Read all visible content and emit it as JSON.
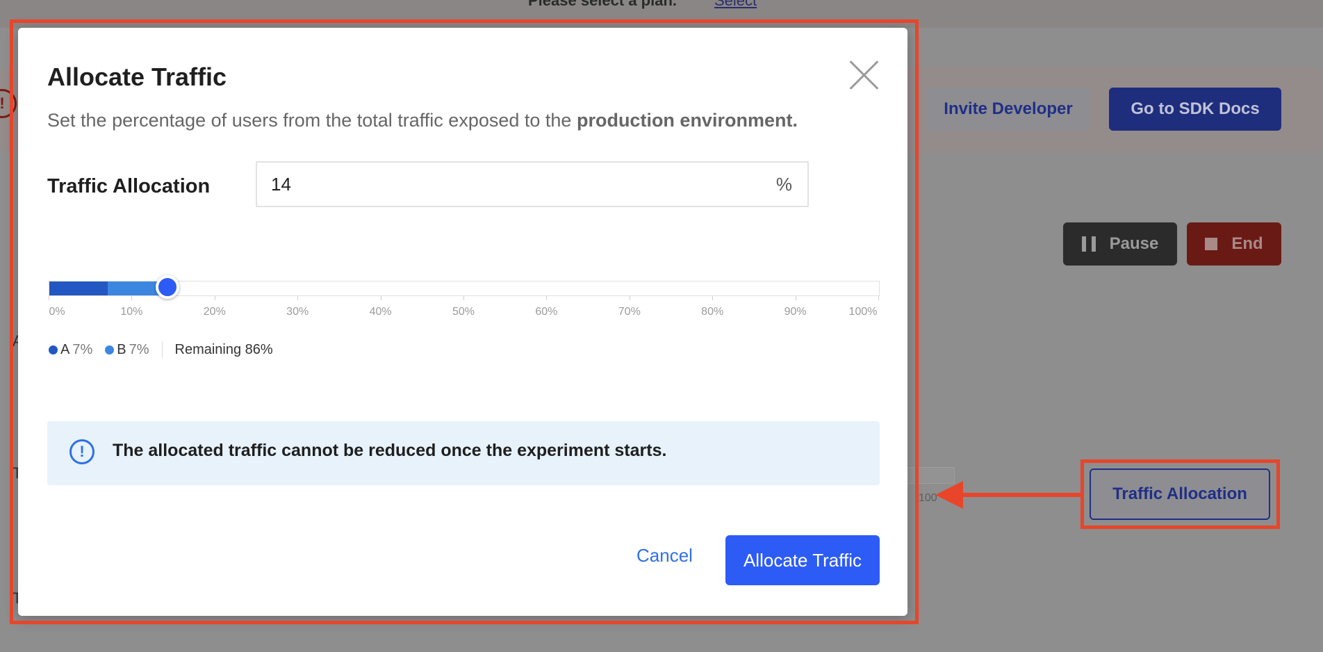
{
  "background": {
    "topbar_text": "Please select a plan.",
    "topbar_link": "Select",
    "banner_icon": "!",
    "invite_button": "Invite Developer",
    "sdk_button": "Go to SDK Docs",
    "pause_button": "Pause",
    "end_button": "End",
    "traffic_allocation_button": "Traffic Allocation",
    "mini_slider_label": "100",
    "side_letters": [
      "A",
      "T",
      "T"
    ]
  },
  "modal": {
    "title": "Allocate Traffic",
    "description_prefix": "Set the percentage of users from the total traffic exposed to the ",
    "description_bold": "production environment.",
    "allocation_label": "Traffic Allocation",
    "allocation_value": "14",
    "allocation_suffix": "%",
    "slider": {
      "value_percent": 14,
      "segments": [
        {
          "name": "A",
          "percent": 7,
          "color": "#2358c2"
        },
        {
          "name": "B",
          "percent": 7,
          "color": "#3d86e0"
        }
      ],
      "tick_labels": [
        "0%",
        "10%",
        "20%",
        "30%",
        "40%",
        "50%",
        "60%",
        "70%",
        "80%",
        "90%",
        "100%"
      ]
    },
    "legend": {
      "a_label": "A",
      "a_percent": "7%",
      "b_label": "B",
      "b_percent": "7%",
      "remaining": "Remaining 86%"
    },
    "info": {
      "icon": "!",
      "text": "The allocated traffic cannot be reduced once the experiment starts."
    },
    "cancel_button": "Cancel",
    "submit_button": "Allocate Traffic"
  },
  "colors": {
    "accent": "#2c5cf5",
    "annotation": "#e8452a",
    "info_background": "#e7f2fb"
  }
}
